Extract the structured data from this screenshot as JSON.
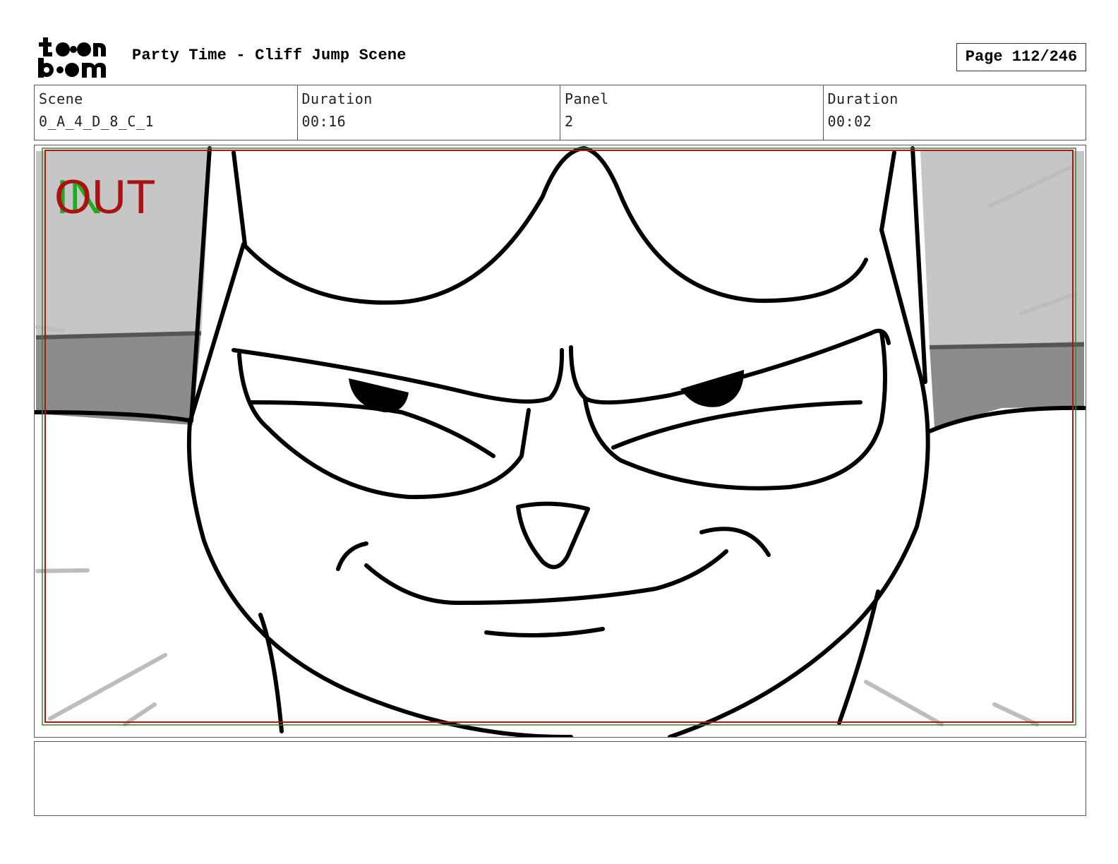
{
  "header": {
    "logo_top": "toon",
    "logo_bottom": "boom",
    "title": "Party Time - Cliff Jump Scene",
    "page_label": "Page 112/246"
  },
  "info": {
    "scene_label": "Scene",
    "scene_value": "0_A_4_D_8_C_1",
    "duration_label": "Duration",
    "duration_value": "00:16",
    "panel_label": "Panel",
    "panel_value": "2",
    "panel_duration_label": "Duration",
    "panel_duration_value": "00:02"
  },
  "panel": {
    "in_marker": "IN",
    "out_marker": "OUT",
    "colors": {
      "in_marker": "#22aa22",
      "out_marker": "#aa1111",
      "frame_outer": "#2e8b2e",
      "frame_inner": "#b01515",
      "sky": "#c6c6c6",
      "wall": "#888888"
    }
  },
  "notes": {
    "text": ""
  }
}
